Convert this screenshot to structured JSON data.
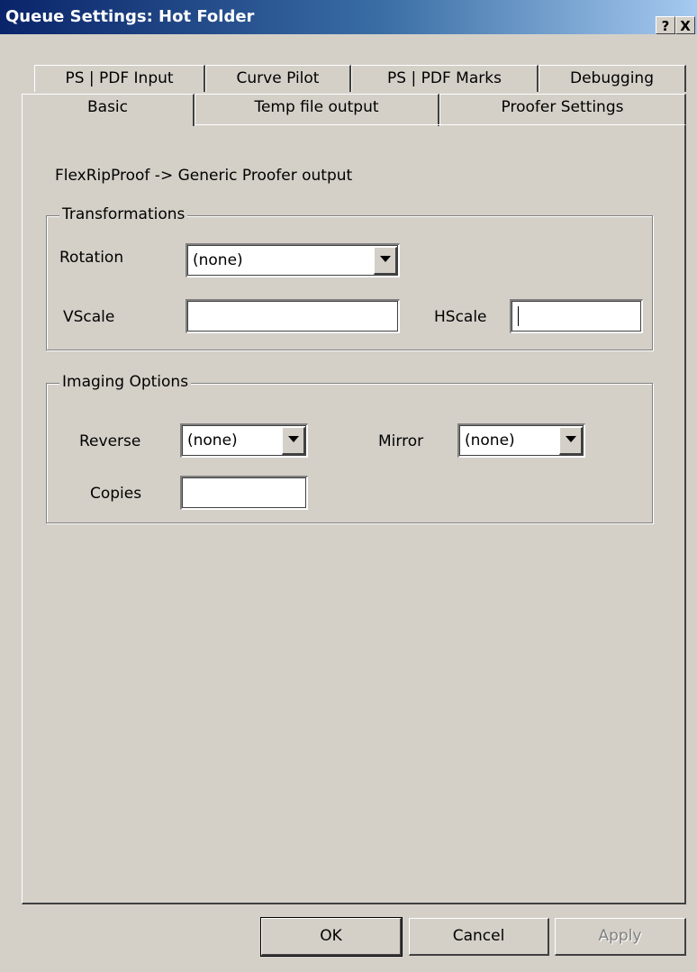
{
  "window": {
    "title": "Queue Settings: Hot Folder",
    "help_label": "?",
    "close_label": "X"
  },
  "tabs": {
    "row1": [
      "PS | PDF Input",
      "Curve Pilot",
      "PS | PDF Marks",
      "Debugging"
    ],
    "row2": [
      "Basic",
      "Temp file output",
      "Proofer Settings"
    ],
    "active": "Basic"
  },
  "panel": {
    "description": "FlexRipProof -> Generic Proofer output",
    "transformations": {
      "title": "Transformations",
      "rotation_label": "Rotation",
      "rotation_value": "(none)",
      "vscale_label": "VScale",
      "vscale_value": "",
      "hscale_label": "HScale",
      "hscale_value": ""
    },
    "imaging": {
      "title": "Imaging Options",
      "reverse_label": "Reverse",
      "reverse_value": "(none)",
      "mirror_label": "Mirror",
      "mirror_value": "(none)",
      "copies_label": "Copies",
      "copies_value": ""
    }
  },
  "buttons": {
    "ok": "OK",
    "cancel": "Cancel",
    "apply": "Apply"
  }
}
